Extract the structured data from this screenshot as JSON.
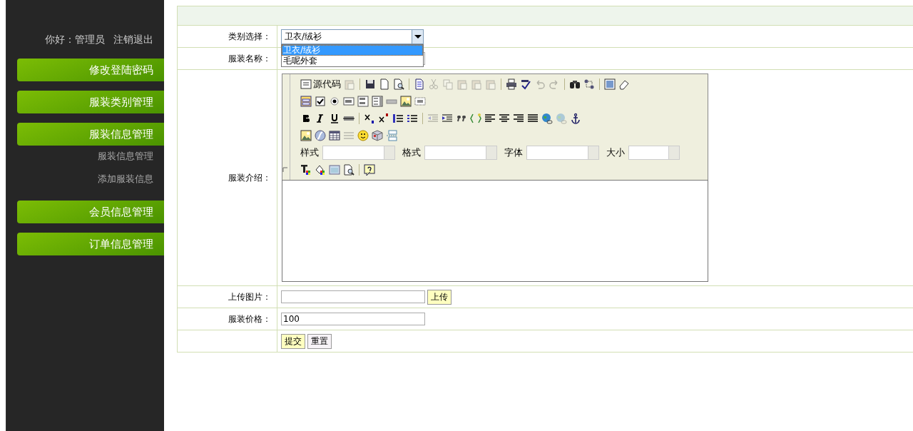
{
  "sidebar": {
    "greeting": "你好：管理员",
    "logout": "注销退出",
    "menu": [
      {
        "label": "修改登陆密码"
      },
      {
        "label": "服装类别管理"
      },
      {
        "label": "服装信息管理",
        "children": [
          {
            "label": "服装信息管理"
          },
          {
            "label": "添加服装信息"
          }
        ]
      },
      {
        "label": "会员信息管理"
      },
      {
        "label": "订单信息管理"
      }
    ]
  },
  "form": {
    "rows": [
      {
        "kind": "select",
        "label": "类别选择：",
        "value": "卫衣/绒衫",
        "expanded": true,
        "options": [
          {
            "label": "卫衣/绒衫",
            "selected": true
          },
          {
            "label": "毛呢外套",
            "selected": false
          }
        ]
      },
      {
        "kind": "text",
        "label": "服装名称："
      },
      {
        "kind": "editor",
        "label": "服装介绍：",
        "toolbar": [
          [
            {
              "kind": "source",
              "label": "源代码"
            },
            {
              "kind": "icon",
              "disabled": true
            },
            {
              "kind": "sep"
            },
            {
              "kind": "icon",
              "disabled": false
            },
            {
              "kind": "icon",
              "disabled": false
            },
            {
              "kind": "icon",
              "disabled": false
            },
            {
              "kind": "sep"
            },
            {
              "kind": "icon",
              "disabled": false
            },
            {
              "kind": "icon",
              "disabled": true
            },
            {
              "kind": "icon",
              "disabled": true
            },
            {
              "kind": "icon",
              "disabled": true
            },
            {
              "kind": "icon",
              "disabled": true
            },
            {
              "kind": "icon",
              "disabled": true
            },
            {
              "kind": "sep"
            },
            {
              "kind": "icon",
              "disabled": false
            },
            {
              "kind": "icon",
              "disabled": false
            },
            {
              "kind": "icon",
              "disabled": true
            },
            {
              "kind": "icon",
              "disabled": true
            },
            {
              "kind": "sep"
            },
            {
              "kind": "icon",
              "disabled": false
            },
            {
              "kind": "icon",
              "disabled": false
            },
            {
              "kind": "sep"
            },
            {
              "kind": "icon",
              "disabled": false
            },
            {
              "kind": "icon",
              "disabled": false
            }
          ],
          [
            {
              "kind": "icon",
              "disabled": false
            },
            {
              "kind": "icon",
              "disabled": false
            },
            {
              "kind": "icon",
              "disabled": false
            },
            {
              "kind": "icon",
              "disabled": false
            },
            {
              "kind": "icon",
              "disabled": false
            },
            {
              "kind": "icon",
              "disabled": false
            },
            {
              "kind": "icon",
              "disabled": false
            },
            {
              "kind": "icon",
              "disabled": false
            },
            {
              "kind": "icon",
              "disabled": false
            }
          ],
          [
            {
              "kind": "icon",
              "disabled": false
            },
            {
              "kind": "icon",
              "disabled": false
            },
            {
              "kind": "icon",
              "disabled": false
            },
            {
              "kind": "icon",
              "disabled": false
            },
            {
              "kind": "sep"
            },
            {
              "kind": "icon",
              "disabled": false
            },
            {
              "kind": "icon",
              "disabled": false
            },
            {
              "kind": "icon",
              "disabled": false
            },
            {
              "kind": "icon",
              "disabled": false
            },
            {
              "kind": "sep"
            },
            {
              "kind": "icon",
              "disabled": true
            },
            {
              "kind": "icon",
              "disabled": false
            },
            {
              "kind": "icon",
              "disabled": false
            },
            {
              "kind": "icon",
              "disabled": false
            },
            {
              "kind": "icon",
              "disabled": false
            },
            {
              "kind": "icon",
              "disabled": false
            },
            {
              "kind": "icon",
              "disabled": false
            },
            {
              "kind": "icon",
              "disabled": false
            },
            {
              "kind": "icon",
              "disabled": false
            },
            {
              "kind": "icon",
              "disabled": true
            },
            {
              "kind": "icon",
              "disabled": false
            }
          ],
          [
            {
              "kind": "icon",
              "disabled": false
            },
            {
              "kind": "icon",
              "disabled": false
            },
            {
              "kind": "icon",
              "disabled": false
            },
            {
              "kind": "icon",
              "disabled": true
            },
            {
              "kind": "icon",
              "disabled": false
            },
            {
              "kind": "icon",
              "disabled": false
            },
            {
              "kind": "icon",
              "disabled": false
            }
          ],
          [
            {
              "kind": "combo",
              "label": "样式"
            },
            {
              "kind": "combo",
              "label": "格式"
            },
            {
              "kind": "combo",
              "label": "字体"
            },
            {
              "kind": "combo",
              "label": "大小"
            }
          ],
          [
            {
              "kind": "icon",
              "disabled": false
            },
            {
              "kind": "icon",
              "disabled": false
            },
            {
              "kind": "icon",
              "disabled": false
            },
            {
              "kind": "icon",
              "disabled": false
            },
            {
              "kind": "sep"
            },
            {
              "kind": "icon",
              "disabled": false
            }
          ]
        ]
      },
      {
        "kind": "upload",
        "label": "上传图片：",
        "button": "上传"
      },
      {
        "kind": "text",
        "label": "服装价格：",
        "value": "100"
      },
      {
        "kind": "actions",
        "buttons": [
          {
            "label": "提交",
            "primary": true
          },
          {
            "label": "重置",
            "primary": false
          }
        ]
      }
    ]
  }
}
